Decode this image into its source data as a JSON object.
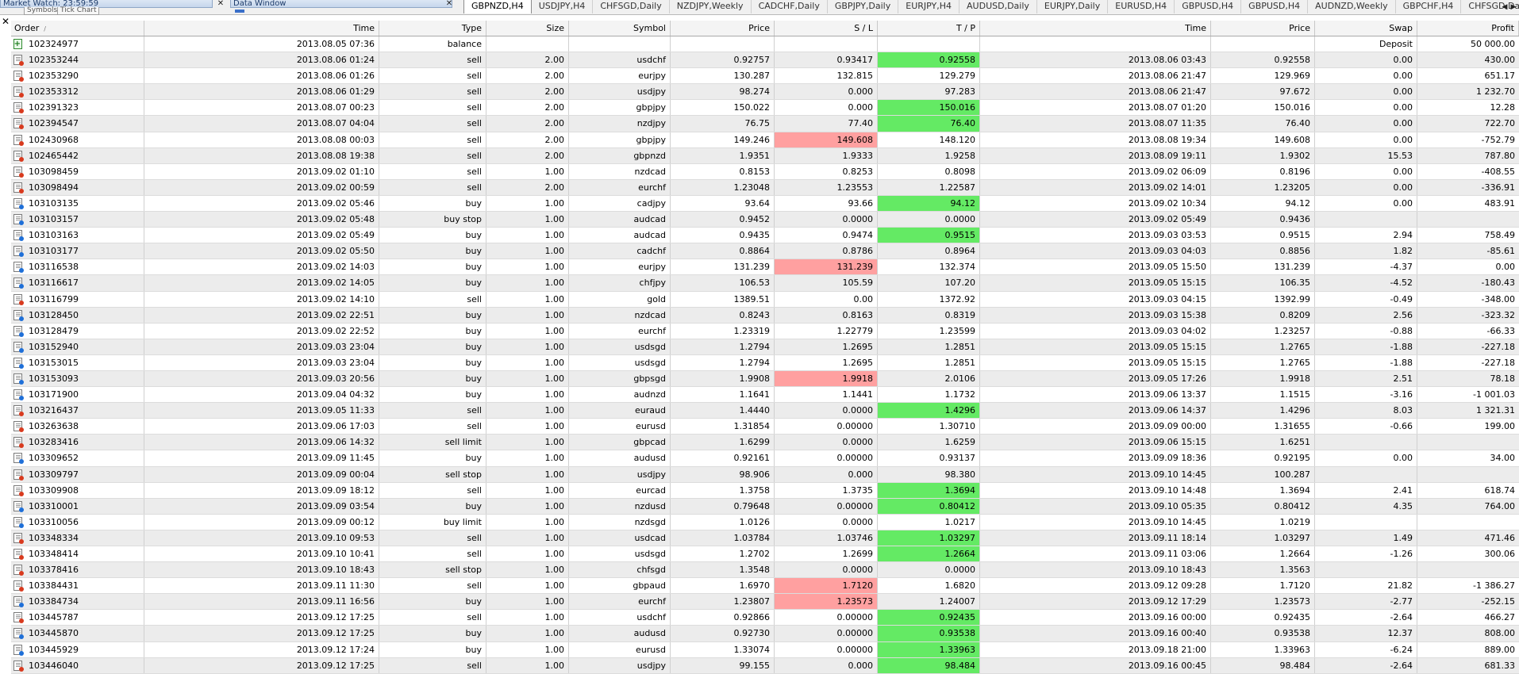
{
  "panels": {
    "market_watch_title": "Market Watch: 23:59:59",
    "data_window_title": "Data Window",
    "symbols_tab": "Symbols",
    "tick_chart_tab": "Tick Chart",
    "close_glyph": "✕"
  },
  "chart_tabs": [
    "GBPNZD,H4",
    "USDJPY,H4",
    "CHFSGD,Daily",
    "NZDJPY,Weekly",
    "CADCHF,Daily",
    "GBPJPY,Daily",
    "EURJPY,H4",
    "AUDUSD,Daily",
    "EURJPY,Daily",
    "EURUSD,H4",
    "GBPUSD,H4",
    "GBPUSD,H4",
    "AUDNZD,Weekly",
    "GBPCHF,H4",
    "CHFSGD,Daily"
  ],
  "active_chart_tab": 0,
  "columns": {
    "order": "Order",
    "sort_marker": "/",
    "time": "Time",
    "type": "Type",
    "size": "Size",
    "symbol": "Symbol",
    "price": "Price",
    "sl": "S / L",
    "tp": "T / P",
    "close_time": "Time",
    "close_price": "Price",
    "swap": "Swap",
    "profit": "Profit"
  },
  "rows": [
    {
      "order": "102324977",
      "time": "2013.08.05 07:36",
      "type": "balance",
      "size": "",
      "symbol": "",
      "price": "",
      "sl": "",
      "tp": "",
      "close_time": "",
      "close_price": "",
      "swap": "Deposit",
      "profit": "50 000.00",
      "hl": ""
    },
    {
      "order": "102353244",
      "time": "2013.08.06 01:24",
      "type": "sell",
      "size": "2.00",
      "symbol": "usdchf",
      "price": "0.92757",
      "sl": "0.93417",
      "tp": "0.92558",
      "close_time": "2013.08.06 03:43",
      "close_price": "0.92558",
      "swap": "0.00",
      "profit": "430.00",
      "hl": "tp"
    },
    {
      "order": "102353290",
      "time": "2013.08.06 01:26",
      "type": "sell",
      "size": "2.00",
      "symbol": "eurjpy",
      "price": "130.287",
      "sl": "132.815",
      "tp": "129.279",
      "close_time": "2013.08.06 21:47",
      "close_price": "129.969",
      "swap": "0.00",
      "profit": "651.17",
      "hl": ""
    },
    {
      "order": "102353312",
      "time": "2013.08.06 01:29",
      "type": "sell",
      "size": "2.00",
      "symbol": "usdjpy",
      "price": "98.274",
      "sl": "0.000",
      "tp": "97.283",
      "close_time": "2013.08.06 21:47",
      "close_price": "97.672",
      "swap": "0.00",
      "profit": "1 232.70",
      "hl": ""
    },
    {
      "order": "102391323",
      "time": "2013.08.07 00:23",
      "type": "sell",
      "size": "2.00",
      "symbol": "gbpjpy",
      "price": "150.022",
      "sl": "0.000",
      "tp": "150.016",
      "close_time": "2013.08.07 01:20",
      "close_price": "150.016",
      "swap": "0.00",
      "profit": "12.28",
      "hl": "tp"
    },
    {
      "order": "102394547",
      "time": "2013.08.07 04:04",
      "type": "sell",
      "size": "2.00",
      "symbol": "nzdjpy",
      "price": "76.75",
      "sl": "77.40",
      "tp": "76.40",
      "close_time": "2013.08.07 11:35",
      "close_price": "76.40",
      "swap": "0.00",
      "profit": "722.70",
      "hl": "tp"
    },
    {
      "order": "102430968",
      "time": "2013.08.08 00:03",
      "type": "sell",
      "size": "2.00",
      "symbol": "gbpjpy",
      "price": "149.246",
      "sl": "149.608",
      "tp": "148.120",
      "close_time": "2013.08.08 19:34",
      "close_price": "149.608",
      "swap": "0.00",
      "profit": "-752.79",
      "hl": "sl"
    },
    {
      "order": "102465442",
      "time": "2013.08.08 19:38",
      "type": "sell",
      "size": "2.00",
      "symbol": "gbpnzd",
      "price": "1.9351",
      "sl": "1.9333",
      "tp": "1.9258",
      "close_time": "2013.08.09 19:11",
      "close_price": "1.9302",
      "swap": "15.53",
      "profit": "787.80",
      "hl": ""
    },
    {
      "order": "103098459",
      "time": "2013.09.02 01:10",
      "type": "sell",
      "size": "1.00",
      "symbol": "nzdcad",
      "price": "0.8153",
      "sl": "0.8253",
      "tp": "0.8098",
      "close_time": "2013.09.02 06:09",
      "close_price": "0.8196",
      "swap": "0.00",
      "profit": "-408.55",
      "hl": ""
    },
    {
      "order": "103098494",
      "time": "2013.09.02 00:59",
      "type": "sell",
      "size": "2.00",
      "symbol": "eurchf",
      "price": "1.23048",
      "sl": "1.23553",
      "tp": "1.22587",
      "close_time": "2013.09.02 14:01",
      "close_price": "1.23205",
      "swap": "0.00",
      "profit": "-336.91",
      "hl": ""
    },
    {
      "order": "103103135",
      "time": "2013.09.02 05:46",
      "type": "buy",
      "size": "1.00",
      "symbol": "cadjpy",
      "price": "93.64",
      "sl": "93.66",
      "tp": "94.12",
      "close_time": "2013.09.02 10:34",
      "close_price": "94.12",
      "swap": "0.00",
      "profit": "483.91",
      "hl": "tp"
    },
    {
      "order": "103103157",
      "time": "2013.09.02 05:48",
      "type": "buy stop",
      "size": "1.00",
      "symbol": "audcad",
      "price": "0.9452",
      "sl": "0.0000",
      "tp": "0.0000",
      "close_time": "2013.09.02 05:49",
      "close_price": "0.9436",
      "swap": "",
      "profit": "",
      "hl": ""
    },
    {
      "order": "103103163",
      "time": "2013.09.02 05:49",
      "type": "buy",
      "size": "1.00",
      "symbol": "audcad",
      "price": "0.9435",
      "sl": "0.9474",
      "tp": "0.9515",
      "close_time": "2013.09.03 03:53",
      "close_price": "0.9515",
      "swap": "2.94",
      "profit": "758.49",
      "hl": "tp"
    },
    {
      "order": "103103177",
      "time": "2013.09.02 05:50",
      "type": "buy",
      "size": "1.00",
      "symbol": "cadchf",
      "price": "0.8864",
      "sl": "0.8786",
      "tp": "0.8964",
      "close_time": "2013.09.03 04:03",
      "close_price": "0.8856",
      "swap": "1.82",
      "profit": "-85.61",
      "hl": ""
    },
    {
      "order": "103116538",
      "time": "2013.09.02 14:03",
      "type": "buy",
      "size": "1.00",
      "symbol": "eurjpy",
      "price": "131.239",
      "sl": "131.239",
      "tp": "132.374",
      "close_time": "2013.09.05 15:50",
      "close_price": "131.239",
      "swap": "-4.37",
      "profit": "0.00",
      "hl": "sl"
    },
    {
      "order": "103116617",
      "time": "2013.09.02 14:05",
      "type": "buy",
      "size": "1.00",
      "symbol": "chfjpy",
      "price": "106.53",
      "sl": "105.59",
      "tp": "107.20",
      "close_time": "2013.09.05 15:15",
      "close_price": "106.35",
      "swap": "-4.52",
      "profit": "-180.43",
      "hl": ""
    },
    {
      "order": "103116799",
      "time": "2013.09.02 14:10",
      "type": "sell",
      "size": "1.00",
      "symbol": "gold",
      "price": "1389.51",
      "sl": "0.00",
      "tp": "1372.92",
      "close_time": "2013.09.03 04:15",
      "close_price": "1392.99",
      "swap": "-0.49",
      "profit": "-348.00",
      "hl": ""
    },
    {
      "order": "103128450",
      "time": "2013.09.02 22:51",
      "type": "buy",
      "size": "1.00",
      "symbol": "nzdcad",
      "price": "0.8243",
      "sl": "0.8163",
      "tp": "0.8319",
      "close_time": "2013.09.03 15:38",
      "close_price": "0.8209",
      "swap": "2.56",
      "profit": "-323.32",
      "hl": ""
    },
    {
      "order": "103128479",
      "time": "2013.09.02 22:52",
      "type": "buy",
      "size": "1.00",
      "symbol": "eurchf",
      "price": "1.23319",
      "sl": "1.22779",
      "tp": "1.23599",
      "close_time": "2013.09.03 04:02",
      "close_price": "1.23257",
      "swap": "-0.88",
      "profit": "-66.33",
      "hl": ""
    },
    {
      "order": "103152940",
      "time": "2013.09.03 23:04",
      "type": "buy",
      "size": "1.00",
      "symbol": "usdsgd",
      "price": "1.2794",
      "sl": "1.2695",
      "tp": "1.2851",
      "close_time": "2013.09.05 15:15",
      "close_price": "1.2765",
      "swap": "-1.88",
      "profit": "-227.18",
      "hl": ""
    },
    {
      "order": "103153015",
      "time": "2013.09.03 23:04",
      "type": "buy",
      "size": "1.00",
      "symbol": "usdsgd",
      "price": "1.2794",
      "sl": "1.2695",
      "tp": "1.2851",
      "close_time": "2013.09.05 15:15",
      "close_price": "1.2765",
      "swap": "-1.88",
      "profit": "-227.18",
      "hl": ""
    },
    {
      "order": "103153093",
      "time": "2013.09.03 20:56",
      "type": "buy",
      "size": "1.00",
      "symbol": "gbpsgd",
      "price": "1.9908",
      "sl": "1.9918",
      "tp": "2.0106",
      "close_time": "2013.09.05 17:26",
      "close_price": "1.9918",
      "swap": "2.51",
      "profit": "78.18",
      "hl": "sl"
    },
    {
      "order": "103171900",
      "time": "2013.09.04 04:32",
      "type": "buy",
      "size": "1.00",
      "symbol": "audnzd",
      "price": "1.1641",
      "sl": "1.1441",
      "tp": "1.1732",
      "close_time": "2013.09.06 13:37",
      "close_price": "1.1515",
      "swap": "-3.16",
      "profit": "-1 001.03",
      "hl": ""
    },
    {
      "order": "103216437",
      "time": "2013.09.05 11:33",
      "type": "sell",
      "size": "1.00",
      "symbol": "euraud",
      "price": "1.4440",
      "sl": "0.0000",
      "tp": "1.4296",
      "close_time": "2013.09.06 14:37",
      "close_price": "1.4296",
      "swap": "8.03",
      "profit": "1 321.31",
      "hl": "tp"
    },
    {
      "order": "103263638",
      "time": "2013.09.06 17:03",
      "type": "sell",
      "size": "1.00",
      "symbol": "eurusd",
      "price": "1.31854",
      "sl": "0.00000",
      "tp": "1.30710",
      "close_time": "2013.09.09 00:00",
      "close_price": "1.31655",
      "swap": "-0.66",
      "profit": "199.00",
      "hl": ""
    },
    {
      "order": "103283416",
      "time": "2013.09.06 14:32",
      "type": "sell limit",
      "size": "1.00",
      "symbol": "gbpcad",
      "price": "1.6299",
      "sl": "0.0000",
      "tp": "1.6259",
      "close_time": "2013.09.06 15:15",
      "close_price": "1.6251",
      "swap": "",
      "profit": "",
      "hl": ""
    },
    {
      "order": "103309652",
      "time": "2013.09.09 11:45",
      "type": "buy",
      "size": "1.00",
      "symbol": "audusd",
      "price": "0.92161",
      "sl": "0.00000",
      "tp": "0.93137",
      "close_time": "2013.09.09 18:36",
      "close_price": "0.92195",
      "swap": "0.00",
      "profit": "34.00",
      "hl": ""
    },
    {
      "order": "103309797",
      "time": "2013.09.09 00:04",
      "type": "sell stop",
      "size": "1.00",
      "symbol": "usdjpy",
      "price": "98.906",
      "sl": "0.000",
      "tp": "98.380",
      "close_time": "2013.09.10 14:45",
      "close_price": "100.287",
      "swap": "",
      "profit": "",
      "hl": ""
    },
    {
      "order": "103309908",
      "time": "2013.09.09 18:12",
      "type": "sell",
      "size": "1.00",
      "symbol": "eurcad",
      "price": "1.3758",
      "sl": "1.3735",
      "tp": "1.3694",
      "close_time": "2013.09.10 14:48",
      "close_price": "1.3694",
      "swap": "2.41",
      "profit": "618.74",
      "hl": "tp"
    },
    {
      "order": "103310001",
      "time": "2013.09.09 03:54",
      "type": "buy",
      "size": "1.00",
      "symbol": "nzdusd",
      "price": "0.79648",
      "sl": "0.00000",
      "tp": "0.80412",
      "close_time": "2013.09.10 05:35",
      "close_price": "0.80412",
      "swap": "4.35",
      "profit": "764.00",
      "hl": "tp"
    },
    {
      "order": "103310056",
      "time": "2013.09.09 00:12",
      "type": "buy limit",
      "size": "1.00",
      "symbol": "nzdsgd",
      "price": "1.0126",
      "sl": "0.0000",
      "tp": "1.0217",
      "close_time": "2013.09.10 14:45",
      "close_price": "1.0219",
      "swap": "",
      "profit": "",
      "hl": ""
    },
    {
      "order": "103348334",
      "time": "2013.09.10 09:53",
      "type": "sell",
      "size": "1.00",
      "symbol": "usdcad",
      "price": "1.03784",
      "sl": "1.03746",
      "tp": "1.03297",
      "close_time": "2013.09.11 18:14",
      "close_price": "1.03297",
      "swap": "1.49",
      "profit": "471.46",
      "hl": "tp"
    },
    {
      "order": "103348414",
      "time": "2013.09.10 10:41",
      "type": "sell",
      "size": "1.00",
      "symbol": "usdsgd",
      "price": "1.2702",
      "sl": "1.2699",
      "tp": "1.2664",
      "close_time": "2013.09.11 03:06",
      "close_price": "1.2664",
      "swap": "-1.26",
      "profit": "300.06",
      "hl": "tp"
    },
    {
      "order": "103378416",
      "time": "2013.09.10 18:43",
      "type": "sell stop",
      "size": "1.00",
      "symbol": "chfsgd",
      "price": "1.3548",
      "sl": "0.0000",
      "tp": "0.0000",
      "close_time": "2013.09.10 18:43",
      "close_price": "1.3563",
      "swap": "",
      "profit": "",
      "hl": ""
    },
    {
      "order": "103384431",
      "time": "2013.09.11 11:30",
      "type": "sell",
      "size": "1.00",
      "symbol": "gbpaud",
      "price": "1.6970",
      "sl": "1.7120",
      "tp": "1.6820",
      "close_time": "2013.09.12 09:28",
      "close_price": "1.7120",
      "swap": "21.82",
      "profit": "-1 386.27",
      "hl": "sl"
    },
    {
      "order": "103384734",
      "time": "2013.09.11 16:56",
      "type": "buy",
      "size": "1.00",
      "symbol": "eurchf",
      "price": "1.23807",
      "sl": "1.23573",
      "tp": "1.24007",
      "close_time": "2013.09.12 17:29",
      "close_price": "1.23573",
      "swap": "-2.77",
      "profit": "-252.15",
      "hl": "sl"
    },
    {
      "order": "103445787",
      "time": "2013.09.12 17:25",
      "type": "sell",
      "size": "1.00",
      "symbol": "usdchf",
      "price": "0.92866",
      "sl": "0.00000",
      "tp": "0.92435",
      "close_time": "2013.09.16 00:00",
      "close_price": "0.92435",
      "swap": "-2.64",
      "profit": "466.27",
      "hl": "tp"
    },
    {
      "order": "103445870",
      "time": "2013.09.12 17:25",
      "type": "buy",
      "size": "1.00",
      "symbol": "audusd",
      "price": "0.92730",
      "sl": "0.00000",
      "tp": "0.93538",
      "close_time": "2013.09.16 00:40",
      "close_price": "0.93538",
      "swap": "12.37",
      "profit": "808.00",
      "hl": "tp"
    },
    {
      "order": "103445929",
      "time": "2013.09.12 17:24",
      "type": "buy",
      "size": "1.00",
      "symbol": "eurusd",
      "price": "1.33074",
      "sl": "0.00000",
      "tp": "1.33963",
      "close_time": "2013.09.18 21:00",
      "close_price": "1.33963",
      "swap": "-6.24",
      "profit": "889.00",
      "hl": "tp"
    },
    {
      "order": "103446040",
      "time": "2013.09.12 17:25",
      "type": "sell",
      "size": "1.00",
      "symbol": "usdjpy",
      "price": "99.155",
      "sl": "0.000",
      "tp": "98.484",
      "close_time": "2013.09.16 00:45",
      "close_price": "98.484",
      "swap": "-2.64",
      "profit": "681.33",
      "hl": "tp"
    }
  ],
  "colors": {
    "sl_hit": "#ffa0a0",
    "tp_hit": "#64ea64",
    "alt_row": "#ececec",
    "sell_icon": "#d83a1e",
    "buy_icon": "#1e6fd8"
  }
}
